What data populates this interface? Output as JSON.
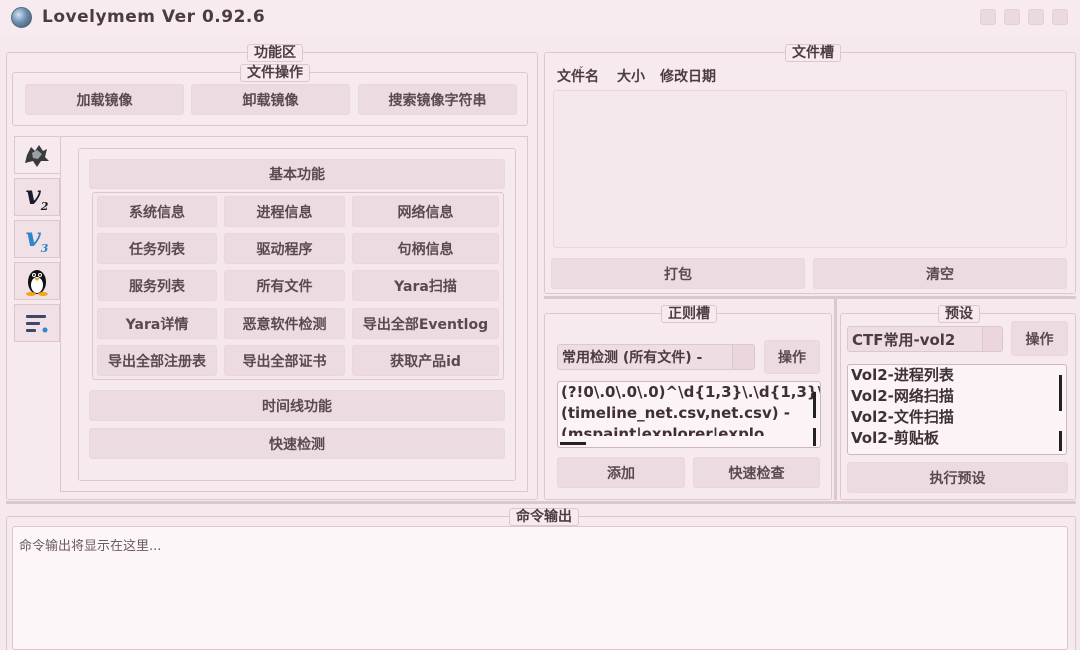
{
  "window": {
    "title": "Lovelymem Ver 0.92.6"
  },
  "function_area": {
    "title": "功能区",
    "file_ops": {
      "title": "文件操作",
      "buttons": [
        "加载镜像",
        "卸载镜像",
        "搜索镜像字符串"
      ]
    },
    "side_tabs": [
      {
        "icon": "volatility-icon",
        "label": ""
      },
      {
        "icon": "v2-icon",
        "label": "v",
        "sub": "2"
      },
      {
        "icon": "v3-icon",
        "label": "v",
        "sub": "3"
      },
      {
        "icon": "linux-penguin-icon",
        "label": ""
      },
      {
        "icon": "list-menu-icon",
        "label": ""
      }
    ],
    "basic": {
      "title": "基本功能",
      "grid": [
        [
          "系统信息",
          "进程信息",
          "网络信息"
        ],
        [
          "任务列表",
          "驱动程序",
          "句柄信息"
        ],
        [
          "服务列表",
          "所有文件",
          "Yara扫描"
        ],
        [
          "Yara详情",
          "恶意软件检测",
          "导出全部Eventlog"
        ],
        [
          "导出全部注册表",
          "导出全部证书",
          "获取产品id"
        ]
      ],
      "timeline": "时间线功能",
      "quick_check": "快速检测"
    }
  },
  "file_slot": {
    "title": "文件槽",
    "columns": [
      "文件名",
      "大小",
      "修改日期"
    ],
    "pack_button": "打包",
    "clear_button": "清空"
  },
  "regex_slot": {
    "title": "正则槽",
    "combo_value": "常用检测 (所有文件) -",
    "op_button": "操作",
    "lines": [
      "(?!0\\.0\\.0\\.0)^\\d{1,3}\\.\\d{1,3}\\.",
      " (timeline_net.csv,net.csv) -",
      "(mspaint|explorer|explo"
    ],
    "add_button": "添加",
    "quick_check_button": "快速检查"
  },
  "preset": {
    "title": "预设",
    "combo_value": "CTF常用-vol2",
    "op_button": "操作",
    "items": [
      "Vol2-进程列表",
      "Vol2-网络扫描",
      "Vol2-文件扫描",
      "Vol2-剪贴板"
    ],
    "run_button": "执行预设"
  },
  "command_output": {
    "title": "命令输出",
    "placeholder": "命令输出将显示在这里..."
  },
  "colors": {
    "background": "#f6e9ed",
    "button": "#ecdbe1",
    "border": "#dcc7ce",
    "text": "#4b3c42"
  }
}
